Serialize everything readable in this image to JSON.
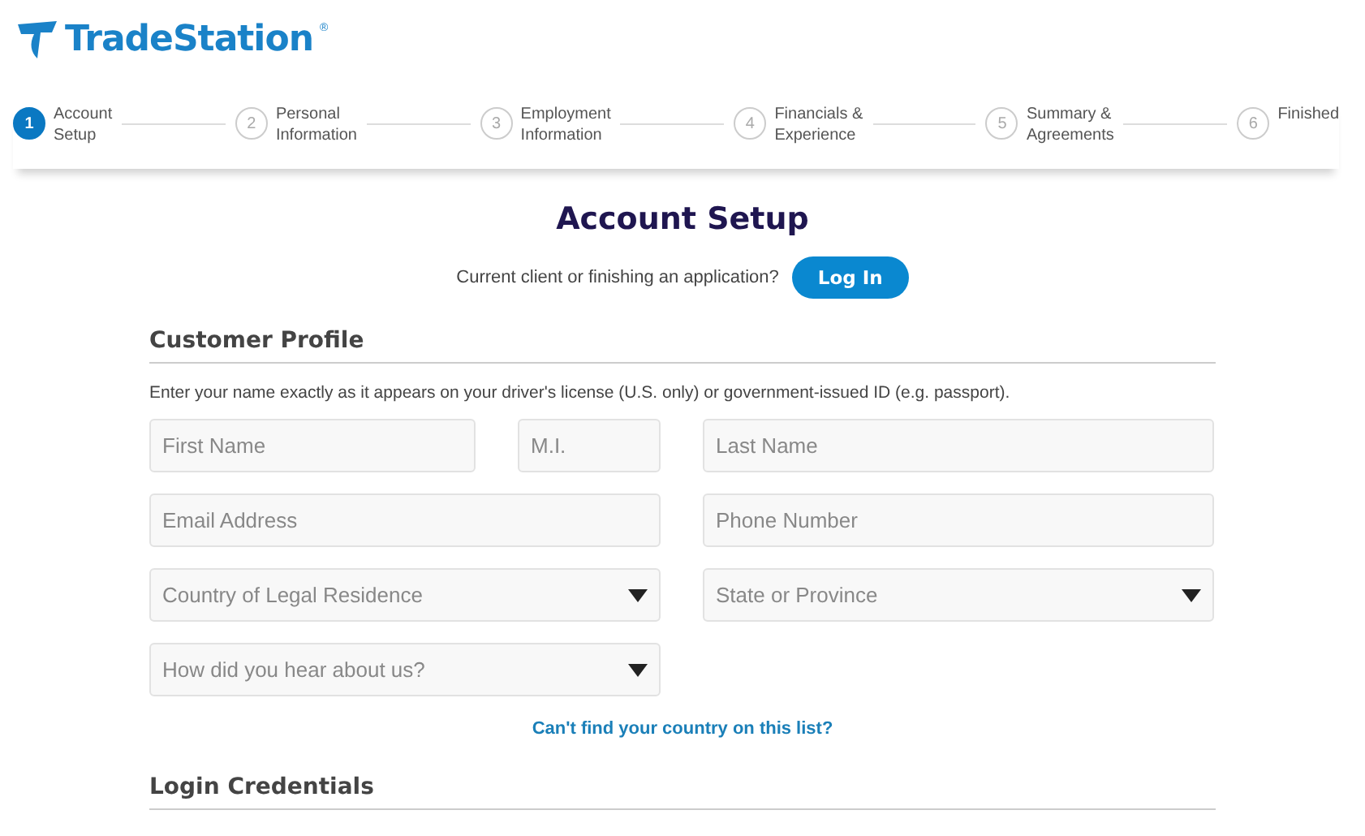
{
  "logo": {
    "name": "TradeStation",
    "mark": "®"
  },
  "steps": [
    {
      "number": "1",
      "label": "Account\nSetup",
      "selected": true
    },
    {
      "number": "2",
      "label": "Personal\nInformation",
      "selected": false
    },
    {
      "number": "3",
      "label": "Employment\nInformation",
      "selected": false
    },
    {
      "number": "4",
      "label": "Financials &\nExperience",
      "selected": false
    },
    {
      "number": "5",
      "label": "Summary &\nAgreements",
      "selected": false
    },
    {
      "number": "6",
      "label": "Finished",
      "selected": false
    }
  ],
  "title": "Account Setup",
  "login_prompt": {
    "text": "Current client or finishing an application?",
    "button": "Log In"
  },
  "sections": [
    {
      "heading": "Customer Profile",
      "note": "Enter your name exactly as it appears on your driver's license (U.S. only) or government-issued ID (e.g. passport).",
      "rows": [
        [
          {
            "kind": "text",
            "placeholder": "First Name"
          },
          {
            "kind": "text",
            "placeholder": "M.I."
          },
          {
            "kind": "text",
            "placeholder": "Last Name"
          }
        ],
        [
          {
            "kind": "text",
            "placeholder": "Email Address"
          },
          {
            "kind": "text",
            "placeholder": "Phone Number"
          }
        ],
        [
          {
            "kind": "select",
            "placeholder": "Country of Legal Residence"
          },
          {
            "kind": "select",
            "placeholder": "State or Province"
          }
        ],
        [
          {
            "kind": "select",
            "placeholder": "How did you hear about us?"
          }
        ]
      ],
      "link": "Can't find your country on this list?"
    },
    {
      "heading": "Login Credentials"
    }
  ]
}
